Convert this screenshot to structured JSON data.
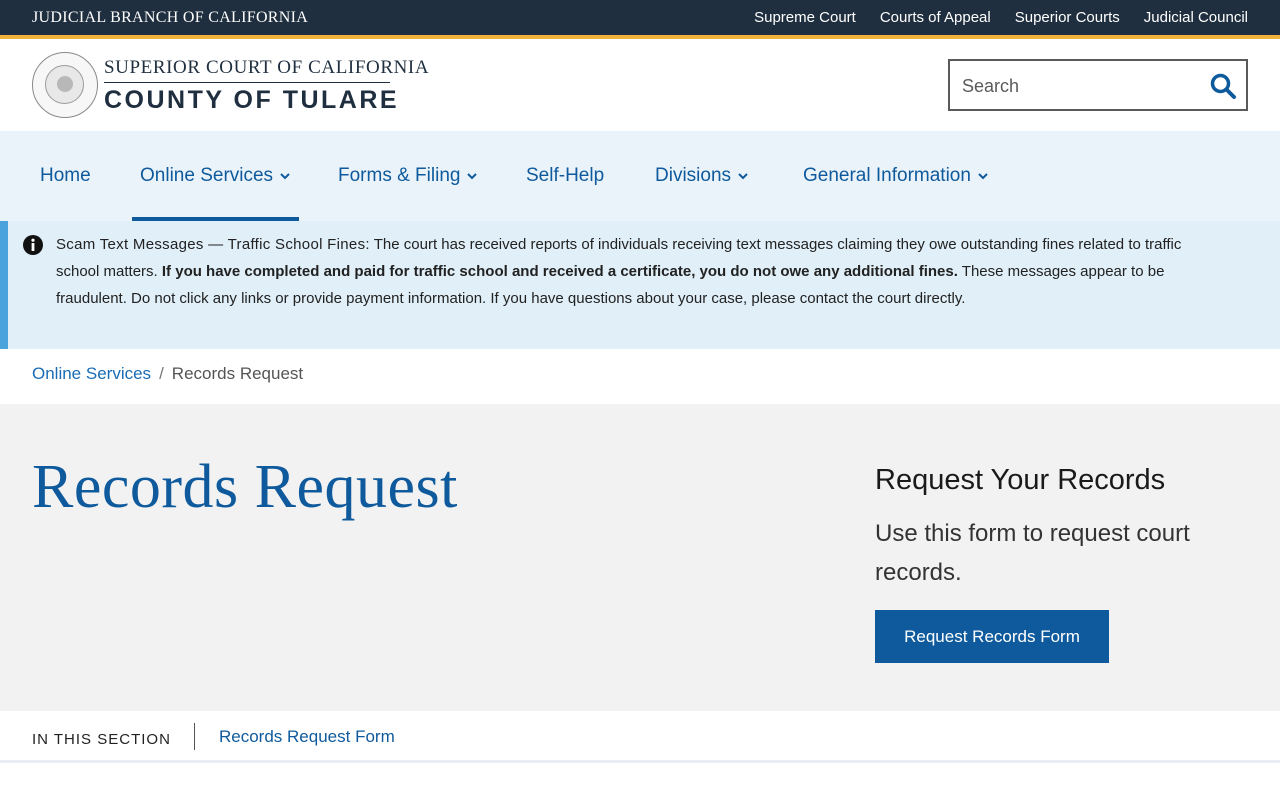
{
  "topbar": {
    "branch": "JUDICIAL BRANCH OF CALIFORNIA",
    "links": [
      "Supreme Court",
      "Courts of Appeal",
      "Superior Courts",
      "Judicial Council"
    ]
  },
  "header": {
    "court_line1": "SUPERIOR COURT OF CALIFORNIA",
    "court_line2": "COUNTY OF TULARE",
    "seal_icon": "court-seal-icon"
  },
  "search": {
    "placeholder": "Search",
    "icon": "search-icon"
  },
  "nav": {
    "items": [
      {
        "label": "Home",
        "has_dropdown": false
      },
      {
        "label": "Online Services",
        "has_dropdown": true,
        "active": true
      },
      {
        "label": "Forms & Filing",
        "has_dropdown": true
      },
      {
        "label": "Self-Help",
        "has_dropdown": false
      },
      {
        "label": "Divisions",
        "has_dropdown": true
      },
      {
        "label": "General Information",
        "has_dropdown": true
      }
    ]
  },
  "alert": {
    "icon": "info-icon",
    "lead": "Scam Text Messages — Traffic School Fines:",
    "text1": "The court has received reports of individuals receiving text messages claiming they owe outstanding fines related to traffic school matters.",
    "bold": "If you have completed and paid for traffic school and received a certificate, you do not owe any additional fines.",
    "text2": "These messages appear to be fraudulent. Do not click any links or provide payment information. If you have questions about your case, please contact the court directly."
  },
  "breadcrumb": {
    "parent": "Online Services",
    "separator": "/",
    "current": "Records Request"
  },
  "hero": {
    "title": "Records Request",
    "side_title": "Request Your Records",
    "side_desc": "Use this form to request court records.",
    "cta": "Request Records Form"
  },
  "section": {
    "label": "IN THIS SECTION",
    "links": [
      "Records Request Form"
    ]
  },
  "colors": {
    "topbar": "#1f2f3f",
    "accent": "#f2b33d",
    "brand_blue": "#0e5a9c",
    "nav_bg": "#eaf3fa",
    "alert_bg": "#e0eff8",
    "alert_bar": "#4aa3dd",
    "hero_bg": "#f2f2f2"
  }
}
